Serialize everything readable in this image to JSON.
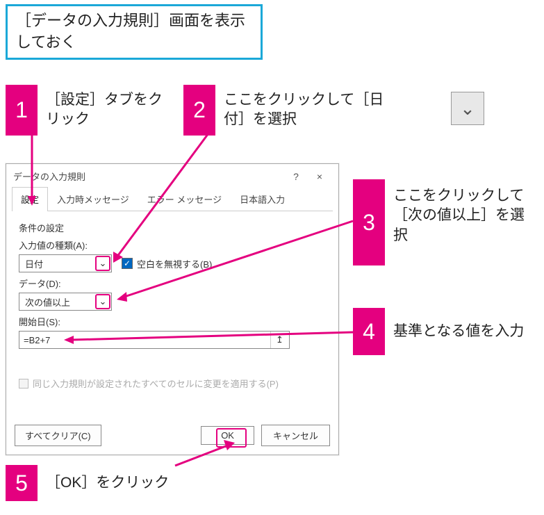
{
  "top_box": "［データの入力規則］画面を表示しておく",
  "callouts": {
    "c1": {
      "num": "1",
      "text": "［設定］タブをクリック"
    },
    "c2": {
      "num": "2",
      "text": "ここをクリックして［日付］を選択"
    },
    "c3": {
      "num": "3",
      "text": "ここをクリックして［次の値以上］を選択"
    },
    "c4": {
      "num": "4",
      "text": "基準となる値を入力"
    },
    "c5": {
      "num": "5",
      "text": "［OK］をクリック"
    }
  },
  "dialog": {
    "title": "データの入力規則",
    "help": "?",
    "close": "×",
    "tabs": {
      "settings": "設定",
      "input_msg": "入力時メッセージ",
      "error_msg": "エラー メッセージ",
      "ime": "日本語入力"
    },
    "section": "条件の設定",
    "labels": {
      "allow": "入力値の種類(A):",
      "ignore_blank": "空白を無視する(B)",
      "data": "データ(D):",
      "start": "開始日(S):"
    },
    "values": {
      "allow": "日付",
      "data": "次の値以上",
      "start": "=B2+7"
    },
    "apply_same": "同じ入力規則が設定されたすべてのセルに変更を適用する(P)",
    "buttons": {
      "clear": "すべてクリア(C)",
      "ok": "OK",
      "cancel": "キャンセル"
    }
  },
  "icons": {
    "chevron_down": "⌄",
    "check": "✓",
    "ref_arrow": "↥"
  }
}
